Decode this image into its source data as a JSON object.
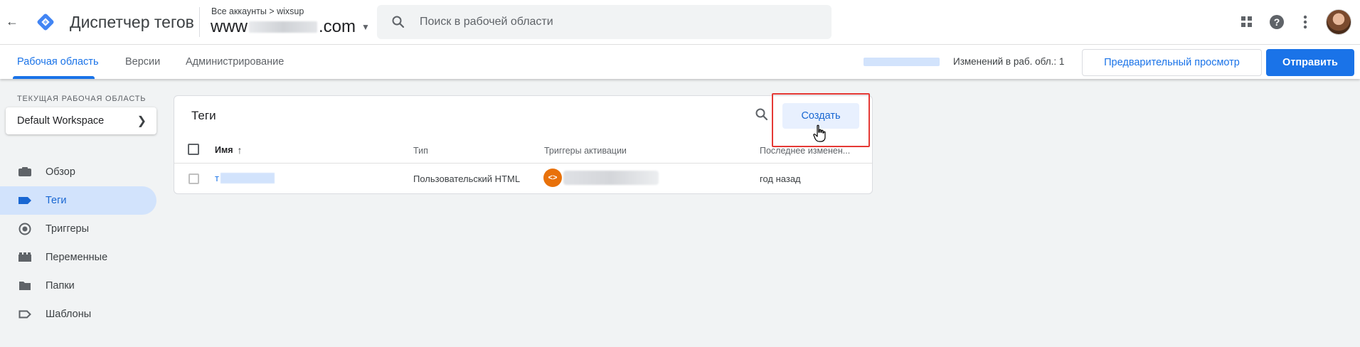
{
  "header": {
    "product_name": "Диспетчер тегов",
    "breadcrumb": "Все аккаунты > wixsup",
    "container_prefix": "www",
    "container_suffix": ".com",
    "search_placeholder": "Поиск в рабочей области"
  },
  "subnav": {
    "tabs": [
      {
        "label": "Рабочая область",
        "active": true
      },
      {
        "label": "Версии"
      },
      {
        "label": "Администрирование"
      }
    ],
    "changes_text": "Изменений в раб. обл.: 1",
    "preview_label": "Предварительный просмотр",
    "submit_label": "Отправить"
  },
  "sidebar": {
    "workspace_label": "ТЕКУЩАЯ РАБОЧАЯ ОБЛАСТЬ",
    "workspace_name": "Default Workspace",
    "items": [
      {
        "label": "Обзор",
        "icon": "briefcase-icon"
      },
      {
        "label": "Теги",
        "icon": "tag-icon",
        "active": true
      },
      {
        "label": "Триггеры",
        "icon": "trigger-icon"
      },
      {
        "label": "Переменные",
        "icon": "variables-icon"
      },
      {
        "label": "Папки",
        "icon": "folder-icon"
      },
      {
        "label": "Шаблоны",
        "icon": "template-icon"
      }
    ]
  },
  "tags_panel": {
    "title": "Теги",
    "create_label": "Создать",
    "columns": [
      "Имя",
      "Тип",
      "Триггеры активации",
      "Последнее изменен..."
    ],
    "rows": [
      {
        "name_visible": "т",
        "type": "Пользовательский HTML",
        "modified": "год назад"
      }
    ]
  },
  "colors": {
    "accent": "#1a73e8",
    "highlight_box": "#e53935",
    "trigger_chip": "#e8710a",
    "active_nav_bg": "#d2e3fc"
  }
}
